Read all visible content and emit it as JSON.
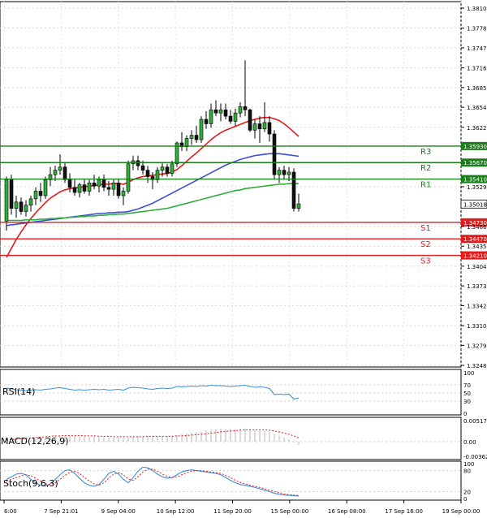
{
  "chart_data": {
    "type": "candlestick",
    "grid": true,
    "ylim": [
      1.3248,
      1.381
    ],
    "price_ticks": [
      "1.38100",
      "1.37785",
      "1.37475",
      "1.37160",
      "1.36850",
      "1.36540",
      "1.36225",
      "1.35290",
      "1.34665",
      "1.34355",
      "1.34040",
      "1.33730",
      "1.33420",
      "1.33105",
      "1.32795",
      "1.32480"
    ],
    "x_tick_labels": [
      "6:00",
      "7 Sep 21:01",
      "9 Sep 04:00",
      "10 Sep 12:00",
      "11 Sep 20:00",
      "15 Sep 00:00",
      "16 Sep 08:00",
      "17 Sep 16:00",
      "19 Sep 00:00"
    ],
    "current_price": {
      "label": "1.35018",
      "value": 1.35018
    },
    "levels": [
      {
        "name": "R3",
        "price_label": "1.35930",
        "value": 1.3593,
        "color": "#1b7d1b"
      },
      {
        "name": "R2",
        "price_label": "1.35670",
        "value": 1.3567,
        "color": "#1b7d1b"
      },
      {
        "name": "R1",
        "price_label": "1.35410",
        "value": 1.3541,
        "color": "#1b7d1b"
      },
      {
        "name": "S1",
        "price_label": "1.34730",
        "value": 1.3473,
        "color": "#e31b1b"
      },
      {
        "name": "S2",
        "price_label": "1.34470",
        "value": 1.3447,
        "color": "#e31b1b"
      },
      {
        "name": "S3",
        "price_label": "1.34210",
        "value": 1.3421,
        "color": "#e31b1b"
      }
    ],
    "candles": [
      [
        1.3475,
        1.3545,
        1.346,
        1.354
      ],
      [
        1.354,
        1.3548,
        1.3485,
        1.3495
      ],
      [
        1.3495,
        1.3515,
        1.348,
        1.3505
      ],
      [
        1.3505,
        1.3512,
        1.3485,
        1.349
      ],
      [
        1.349,
        1.3508,
        1.3482,
        1.35
      ],
      [
        1.35,
        1.3515,
        1.349,
        1.351
      ],
      [
        1.351,
        1.3528,
        1.35,
        1.3522
      ],
      [
        1.3522,
        1.3535,
        1.3505,
        1.3515
      ],
      [
        1.3515,
        1.3545,
        1.351,
        1.354
      ],
      [
        1.354,
        1.356,
        1.353,
        1.3548
      ],
      [
        1.3548,
        1.3562,
        1.3538,
        1.3555
      ],
      [
        1.3555,
        1.358,
        1.3548,
        1.356
      ],
      [
        1.356,
        1.3568,
        1.3535,
        1.354
      ],
      [
        1.354,
        1.355,
        1.352,
        1.3528
      ],
      [
        1.3528,
        1.354,
        1.3515,
        1.352
      ],
      [
        1.352,
        1.3535,
        1.3512,
        1.3532
      ],
      [
        1.3532,
        1.354,
        1.3518,
        1.3522
      ],
      [
        1.3522,
        1.354,
        1.3515,
        1.3535
      ],
      [
        1.3535,
        1.3548,
        1.3525,
        1.353
      ],
      [
        1.353,
        1.3545,
        1.352,
        1.354
      ],
      [
        1.354,
        1.3548,
        1.3522,
        1.3528
      ],
      [
        1.3528,
        1.3538,
        1.3515,
        1.3525
      ],
      [
        1.3525,
        1.354,
        1.3515,
        1.3535
      ],
      [
        1.3535,
        1.3542,
        1.351,
        1.3515
      ],
      [
        1.3515,
        1.3528,
        1.35,
        1.3522
      ],
      [
        1.3522,
        1.357,
        1.3518,
        1.3565
      ],
      [
        1.3565,
        1.3578,
        1.3555,
        1.357
      ],
      [
        1.357,
        1.3578,
        1.3555,
        1.3562
      ],
      [
        1.3562,
        1.357,
        1.3548,
        1.3555
      ],
      [
        1.3555,
        1.3562,
        1.3535,
        1.3545
      ],
      [
        1.3545,
        1.3552,
        1.3525,
        1.354
      ],
      [
        1.354,
        1.356,
        1.3535,
        1.3555
      ],
      [
        1.3555,
        1.3568,
        1.3545,
        1.356
      ],
      [
        1.356,
        1.3565,
        1.3545,
        1.355
      ],
      [
        1.355,
        1.357,
        1.3545,
        1.3565
      ],
      [
        1.3565,
        1.36,
        1.356,
        1.3598
      ],
      [
        1.3598,
        1.3615,
        1.3585,
        1.3592
      ],
      [
        1.3592,
        1.361,
        1.3585,
        1.3605
      ],
      [
        1.3605,
        1.3618,
        1.3595,
        1.361
      ],
      [
        1.361,
        1.3625,
        1.3598,
        1.3603
      ],
      [
        1.3603,
        1.364,
        1.3598,
        1.3635
      ],
      [
        1.3635,
        1.3648,
        1.362,
        1.3628
      ],
      [
        1.3628,
        1.366,
        1.3622,
        1.365
      ],
      [
        1.365,
        1.3665,
        1.364,
        1.3645
      ],
      [
        1.3645,
        1.366,
        1.3632,
        1.365
      ],
      [
        1.365,
        1.366,
        1.3635,
        1.364
      ],
      [
        1.364,
        1.365,
        1.3628,
        1.3632
      ],
      [
        1.3632,
        1.3652,
        1.3625,
        1.3645
      ],
      [
        1.3645,
        1.3662,
        1.3638,
        1.3655
      ],
      [
        1.3655,
        1.3728,
        1.364,
        1.365
      ],
      [
        1.365,
        1.3652,
        1.3615,
        1.3618
      ],
      [
        1.3618,
        1.3635,
        1.3605,
        1.3628
      ],
      [
        1.3628,
        1.364,
        1.3598,
        1.362
      ],
      [
        1.362,
        1.3662,
        1.3615,
        1.363
      ],
      [
        1.363,
        1.364,
        1.36,
        1.3612
      ],
      [
        1.3612,
        1.3618,
        1.354,
        1.3548
      ],
      [
        1.3548,
        1.356,
        1.3535,
        1.3555
      ],
      [
        1.3555,
        1.3562,
        1.354,
        1.3548
      ],
      [
        1.3548,
        1.356,
        1.3538,
        1.3552
      ],
      [
        1.3552,
        1.3558,
        1.349,
        1.3495
      ],
      [
        1.3495,
        1.3518,
        1.349,
        1.3502
      ]
    ],
    "series": [
      {
        "color": "#e31b1b",
        "values": [
          1.3418,
          1.3432,
          1.3446,
          1.3458,
          1.3469,
          1.3479,
          1.3488,
          1.3496,
          1.3504,
          1.3511,
          1.3516,
          1.3521,
          1.3524,
          1.3526,
          1.3527,
          1.3528,
          1.3529,
          1.353,
          1.3531,
          1.3532,
          1.3533,
          1.3533,
          1.3534,
          1.3534,
          1.3533,
          1.3536,
          1.354,
          1.3543,
          1.3545,
          1.3546,
          1.3547,
          1.3548,
          1.3549,
          1.355,
          1.3552,
          1.3556,
          1.3562,
          1.3569,
          1.3576,
          1.3582,
          1.3589,
          1.3596,
          1.3603,
          1.3609,
          1.3614,
          1.3618,
          1.3621,
          1.3624,
          1.3627,
          1.363,
          1.3633,
          1.3635,
          1.3637,
          1.3638,
          1.3638,
          1.3636,
          1.3633,
          1.3628,
          1.3622,
          1.3615,
          1.3608
        ]
      },
      {
        "color": "#3a4fd9",
        "values": [
          1.3468,
          1.3469,
          1.347,
          1.3471,
          1.3472,
          1.3473,
          1.3474,
          1.3475,
          1.3476,
          1.3477,
          1.3478,
          1.3479,
          1.348,
          1.3481,
          1.3482,
          1.3483,
          1.3484,
          1.3485,
          1.3486,
          1.3487,
          1.3487,
          1.3488,
          1.3488,
          1.3489,
          1.3489,
          1.349,
          1.3492,
          1.3494,
          1.3497,
          1.35,
          1.3503,
          1.3507,
          1.3511,
          1.3515,
          1.3519,
          1.3523,
          1.3527,
          1.3531,
          1.3535,
          1.3539,
          1.3543,
          1.3547,
          1.3551,
          1.3555,
          1.3559,
          1.3563,
          1.3566,
          1.3569,
          1.3572,
          1.3574,
          1.3576,
          1.3578,
          1.3579,
          1.358,
          1.3581,
          1.3581,
          1.3581,
          1.358,
          1.3579,
          1.3578,
          1.3577
        ]
      },
      {
        "color": "#2fae3a",
        "values": [
          1.3476,
          1.3476,
          1.3476,
          1.3476,
          1.3477,
          1.3477,
          1.3477,
          1.3478,
          1.3478,
          1.3479,
          1.3479,
          1.348,
          1.348,
          1.3481,
          1.3481,
          1.3482,
          1.3482,
          1.3483,
          1.3483,
          1.3484,
          1.3484,
          1.3485,
          1.3485,
          1.3486,
          1.3486,
          1.3487,
          1.3488,
          1.3489,
          1.349,
          1.3491,
          1.3492,
          1.3493,
          1.3494,
          1.3495,
          1.3497,
          1.3499,
          1.3501,
          1.3503,
          1.3505,
          1.3507,
          1.3509,
          1.3511,
          1.3513,
          1.3515,
          1.3517,
          1.3519,
          1.3521,
          1.3523,
          1.3524,
          1.3526,
          1.3527,
          1.3528,
          1.3529,
          1.353,
          1.3531,
          1.3532,
          1.3533,
          1.3533,
          1.3534,
          1.3534,
          1.3534
        ]
      }
    ],
    "indicators": {
      "rsi": {
        "label": "RSI(14)",
        "ticks": [
          "100",
          "70",
          "50",
          "30",
          "0"
        ],
        "values": [
          62,
          60,
          58,
          57,
          56,
          57,
          58,
          57,
          59,
          60,
          62,
          63,
          61,
          59,
          57,
          58,
          57,
          58,
          59,
          58,
          59,
          57,
          58,
          59,
          57,
          62,
          64,
          63,
          62,
          60,
          59,
          61,
          62,
          61,
          62,
          66,
          65,
          66,
          67,
          66,
          68,
          67,
          69,
          68,
          68,
          67,
          66,
          67,
          68,
          69,
          66,
          64,
          65,
          64,
          61,
          46,
          47,
          46,
          47,
          35,
          38
        ]
      },
      "macd": {
        "label": "MACD(12,26,9)",
        "ticks": [
          "0.005174",
          "0.00",
          "-0.003629"
        ],
        "hist": [
          -0.0005,
          -0.0003,
          -0.0001,
          0.0,
          0.0002,
          0.0004,
          0.0006,
          0.0008,
          0.001,
          0.0012,
          0.0013,
          0.0014,
          0.0015,
          0.0015,
          0.0014,
          0.0013,
          0.0013,
          0.0012,
          0.0012,
          0.0012,
          0.0011,
          0.0011,
          0.001,
          0.001,
          0.0009,
          0.001,
          0.0012,
          0.0013,
          0.0013,
          0.0013,
          0.0013,
          0.0013,
          0.0013,
          0.0013,
          0.0014,
          0.0016,
          0.0018,
          0.002,
          0.0022,
          0.0023,
          0.0025,
          0.0027,
          0.0029,
          0.003,
          0.0031,
          0.0031,
          0.0031,
          0.0031,
          0.0032,
          0.0032,
          0.0031,
          0.0029,
          0.0028,
          0.0026,
          0.0024,
          0.0018,
          0.0014,
          0.001,
          0.0006,
          -0.0002,
          -0.0008
        ],
        "signal": [
          0.0004,
          0.0005,
          0.0006,
          0.0007,
          0.0008,
          0.0009,
          0.001,
          0.0011,
          0.0012,
          0.0013,
          0.0014,
          0.0014,
          0.0015,
          0.0015,
          0.0015,
          0.0015,
          0.0014,
          0.0014,
          0.0014,
          0.0013,
          0.0013,
          0.0013,
          0.0012,
          0.0012,
          0.0012,
          0.0012,
          0.0012,
          0.0012,
          0.0012,
          0.0013,
          0.0013,
          0.0013,
          0.0013,
          0.0013,
          0.0013,
          0.0014,
          0.0014,
          0.0015,
          0.0016,
          0.0017,
          0.0018,
          0.0019,
          0.0021,
          0.0022,
          0.0024,
          0.0025,
          0.0026,
          0.0027,
          0.0028,
          0.0029,
          0.0029,
          0.0029,
          0.0029,
          0.0029,
          0.0028,
          0.0026,
          0.0024,
          0.0021,
          0.0018,
          0.0014,
          0.0009
        ]
      },
      "stoch": {
        "label": "Stoch(9,6,3)",
        "ticks": [
          "100",
          "80",
          "20",
          "0"
        ],
        "k": [
          55,
          62,
          70,
          72,
          68,
          55,
          45,
          38,
          36,
          42,
          55,
          68,
          80,
          82,
          72,
          58,
          45,
          38,
          35,
          40,
          55,
          72,
          78,
          70,
          55,
          45,
          60,
          78,
          90,
          88,
          80,
          70,
          62,
          58,
          60,
          68,
          76,
          80,
          82,
          80,
          78,
          76,
          74,
          72,
          68,
          60,
          52,
          45,
          40,
          38,
          35,
          32,
          28,
          24,
          20,
          15,
          12,
          10,
          9,
          8,
          7
        ],
        "d": [
          50,
          55,
          60,
          65,
          68,
          65,
          58,
          50,
          42,
          40,
          45,
          55,
          66,
          75,
          78,
          72,
          60,
          50,
          42,
          38,
          45,
          58,
          70,
          74,
          68,
          56,
          52,
          62,
          76,
          84,
          84,
          78,
          70,
          64,
          60,
          62,
          68,
          74,
          78,
          80,
          80,
          78,
          76,
          74,
          72,
          66,
          60,
          52,
          46,
          42,
          38,
          35,
          32,
          28,
          24,
          20,
          16,
          13,
          11,
          10,
          9
        ]
      }
    }
  }
}
